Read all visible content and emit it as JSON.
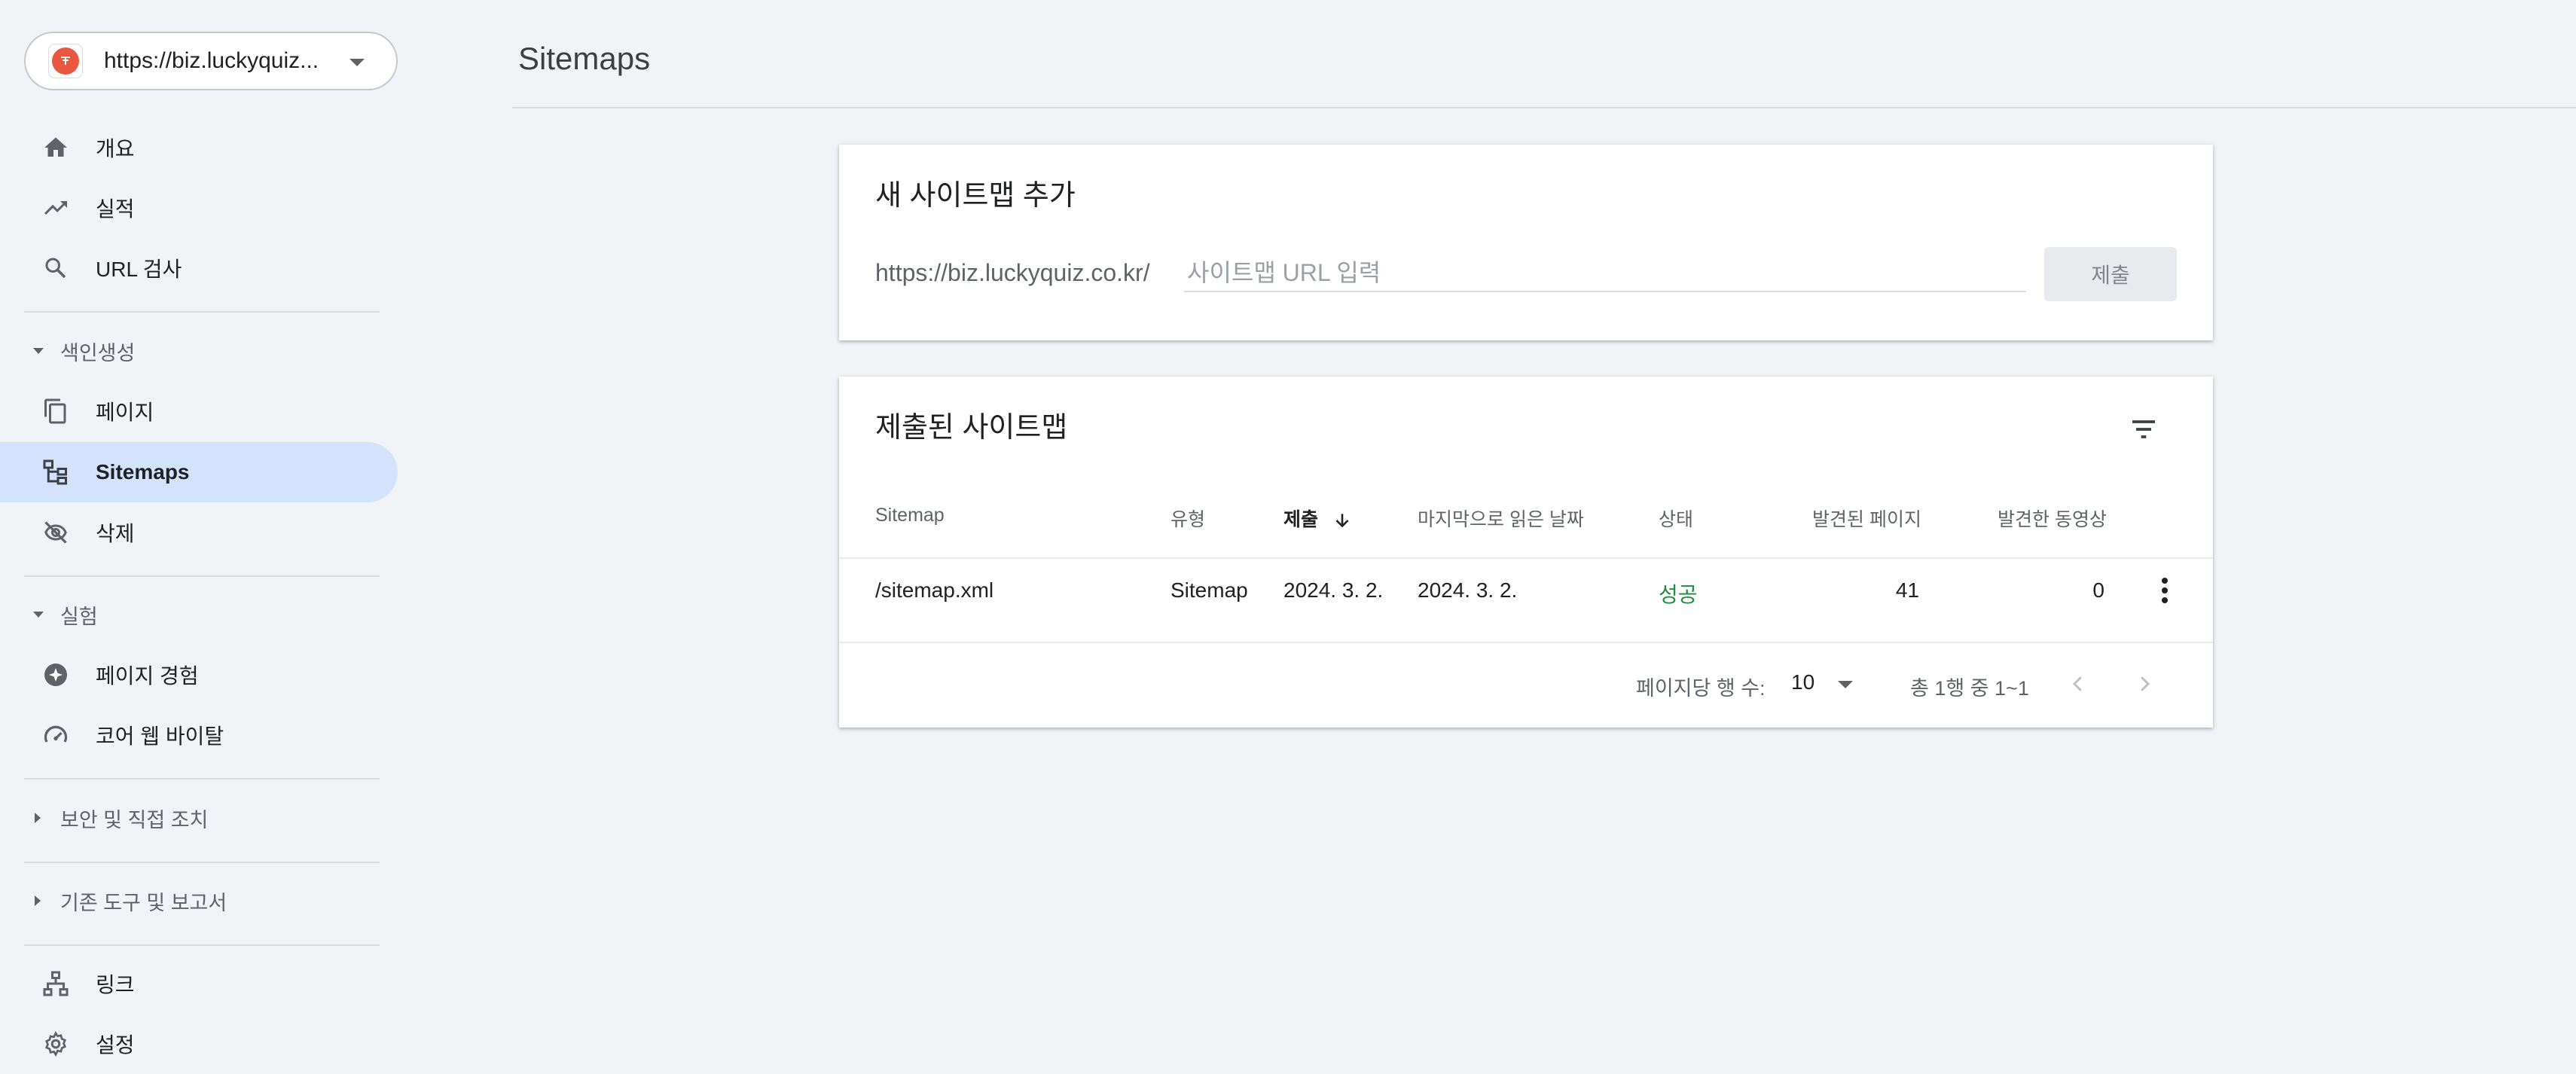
{
  "sidebar": {
    "property": {
      "label": "https://biz.luckyquiz..."
    },
    "items": {
      "overview": "개요",
      "performance": "실적",
      "url_inspection": "URL 검사",
      "pages": "페이지",
      "sitemaps": "Sitemaps",
      "removals": "삭제",
      "page_experience": "페이지 경험",
      "core_web_vitals": "코어 웹 바이탈",
      "links": "링크",
      "settings": "설정"
    },
    "sections": {
      "indexing": "색인생성",
      "experience": "실험",
      "security": "보안 및 직접 조치",
      "legacy": "기존 도구 및 보고서"
    }
  },
  "header": {
    "title": "Sitemaps"
  },
  "add_card": {
    "title": "새 사이트맵 추가",
    "url_prefix": "https://biz.luckyquiz.co.kr/",
    "input_placeholder": "사이트맵 URL 입력",
    "input_value": "",
    "submit_label": "제출"
  },
  "submitted_card": {
    "title": "제출된 사이트맵",
    "columns": {
      "sitemap": "Sitemap",
      "type": "유형",
      "submitted": "제출",
      "last_read": "마지막으로 읽은 날짜",
      "status": "상태",
      "discovered_pages": "발견된 페이지",
      "discovered_videos": "발견한 동영상"
    },
    "sorted_column": "submitted",
    "sort_direction": "descending",
    "rows": [
      {
        "sitemap": "/sitemap.xml",
        "type": "Sitemap",
        "submitted": "2024. 3. 2.",
        "last_read": "2024. 3. 2.",
        "status": "성공",
        "discovered_pages": "41",
        "discovered_videos": "0"
      }
    ],
    "footer": {
      "rows_per_page_label": "페이지당 행 수:",
      "rows_per_page_value": "10",
      "range": "총 1행 중 1~1"
    }
  },
  "colors": {
    "active_nav": "#d3e3fd",
    "success": "#1e8e3e",
    "background": "#f1f3f7"
  }
}
